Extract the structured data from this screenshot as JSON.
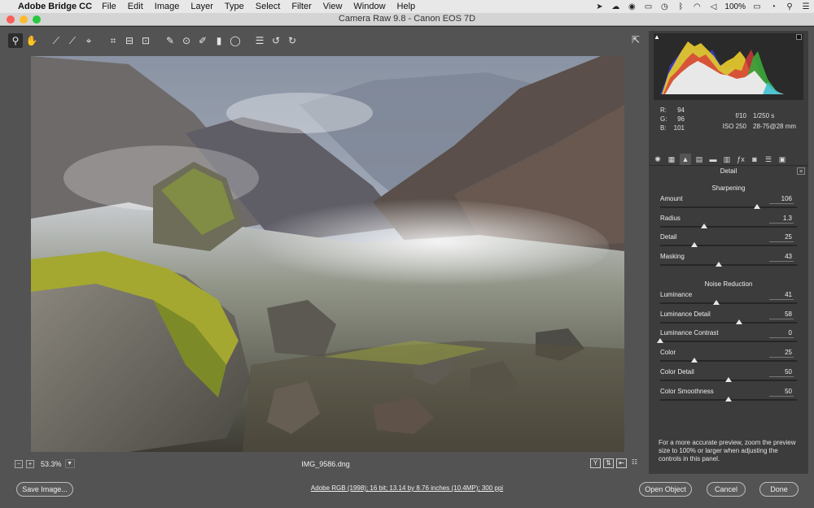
{
  "menubar": {
    "app_name": "Adobe Bridge CC",
    "items": [
      "File",
      "Edit",
      "Image",
      "Layer",
      "Type",
      "Select",
      "Filter",
      "View",
      "Window",
      "Help"
    ],
    "battery": "100%"
  },
  "window": {
    "title": "Camera Raw 9.8  -  Canon EOS 7D"
  },
  "preview": {
    "zoom": "53.3%",
    "filename": "IMG_9586.dng"
  },
  "readout": {
    "r_label": "R:",
    "r": "94",
    "g_label": "G:",
    "g": "96",
    "b_label": "B:",
    "b": "101",
    "aperture": "f/10",
    "shutter": "1/250 s",
    "iso": "ISO 250",
    "lens": "28-75@28 mm"
  },
  "panel": {
    "title": "Detail",
    "sharpening": {
      "title": "Sharpening",
      "sliders": [
        {
          "label": "Amount",
          "value": "106",
          "pos": 0.71
        },
        {
          "label": "Radius",
          "value": "1.3",
          "pos": 0.32
        },
        {
          "label": "Detail",
          "value": "25",
          "pos": 0.25
        },
        {
          "label": "Masking",
          "value": "43",
          "pos": 0.43
        }
      ]
    },
    "noise": {
      "title": "Noise Reduction",
      "sliders": [
        {
          "label": "Luminance",
          "value": "41",
          "pos": 0.41
        },
        {
          "label": "Luminance Detail",
          "value": "58",
          "pos": 0.58
        },
        {
          "label": "Luminance Contrast",
          "value": "0",
          "pos": 0.0
        },
        {
          "label": "Color",
          "value": "25",
          "pos": 0.25
        },
        {
          "label": "Color Detail",
          "value": "50",
          "pos": 0.5
        },
        {
          "label": "Color Smoothness",
          "value": "50",
          "pos": 0.5
        }
      ]
    },
    "hint": "For a more accurate preview, zoom the preview size to 100% or larger when adjusting the controls in this panel."
  },
  "bottom": {
    "save_label": "Save Image...",
    "workflow": "Adobe RGB (1998); 16 bit; 13.14 by 8.76 inches (10.4MP); 300 ppi",
    "open_label": "Open Object",
    "cancel_label": "Cancel",
    "done_label": "Done"
  }
}
